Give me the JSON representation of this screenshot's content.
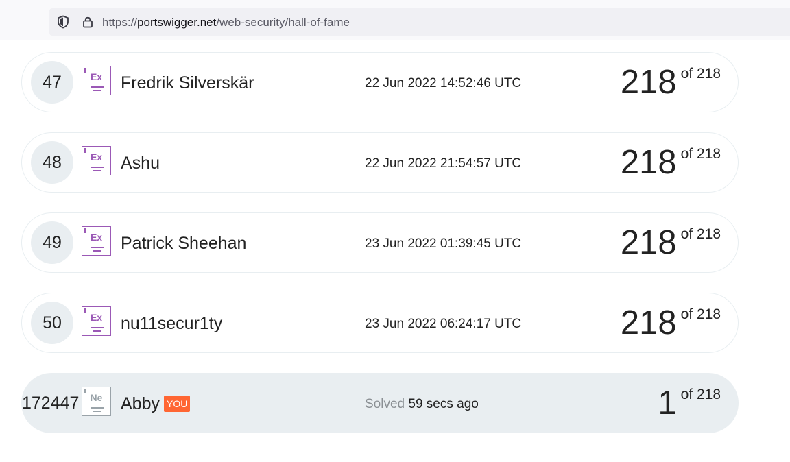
{
  "browser": {
    "url_prefix": "https://",
    "url_domain": "portswigger.net",
    "url_path": "/web-security/hall-of-fame"
  },
  "rows": [
    {
      "rank": "47",
      "badge": "Ex",
      "name": "Fredrik Silverskär",
      "time": "22 Jun 2022 14:52:46 UTC",
      "solved": "218",
      "of": "of 218"
    },
    {
      "rank": "48",
      "badge": "Ex",
      "name": "Ashu",
      "time": "22 Jun 2022 21:54:57 UTC",
      "solved": "218",
      "of": "of 218"
    },
    {
      "rank": "49",
      "badge": "Ex",
      "name": "Patrick Sheehan",
      "time": "23 Jun 2022 01:39:45 UTC",
      "solved": "218",
      "of": "of 218"
    },
    {
      "rank": "50",
      "badge": "Ex",
      "name": "nu11secur1ty",
      "time": "23 Jun 2022 06:24:17 UTC",
      "solved": "218",
      "of": "of 218"
    }
  ],
  "current_user": {
    "rank": "172447",
    "badge": "Ne",
    "name": "Abby",
    "you_label": "YOU",
    "solved_prefix": "Solved",
    "solved_time": "59 secs ago",
    "solved": "1",
    "of": "of 218"
  },
  "colors": {
    "expert_badge": "#9b59b6",
    "novice_badge": "#9aa3a9",
    "you_tag": "#ff6633",
    "rank_circle": "#e9eef1"
  }
}
